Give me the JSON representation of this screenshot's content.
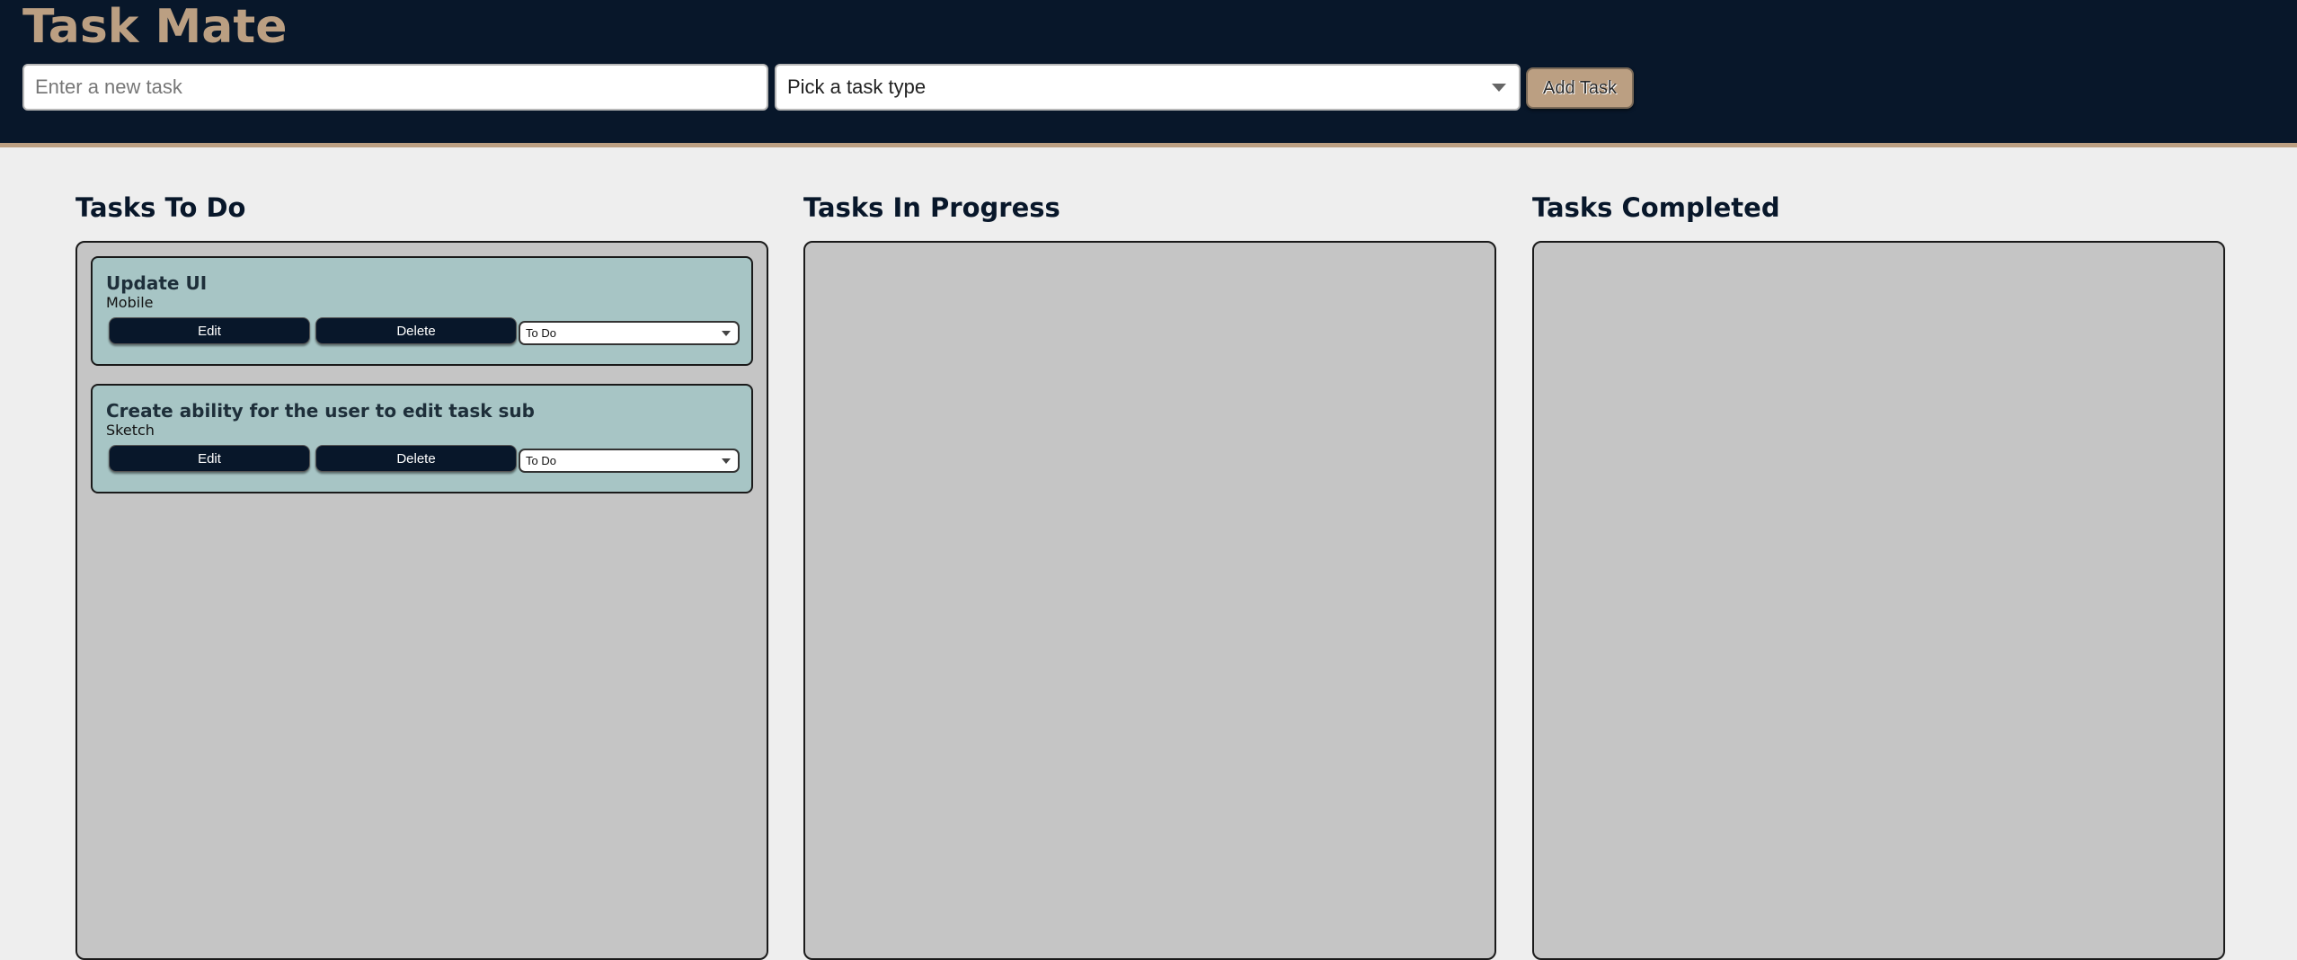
{
  "app": {
    "title": "Task Mate"
  },
  "form": {
    "task_placeholder": "Enter a new task",
    "task_value": "",
    "type_select_value": "Pick a task type",
    "add_button_label": "Add Task"
  },
  "columns": [
    {
      "title": "Tasks To Do",
      "tasks": [
        {
          "title": "Update UI",
          "type": "Mobile",
          "edit_label": "Edit",
          "delete_label": "Delete",
          "status": "To Do"
        },
        {
          "title": "Create ability for the user to edit task sub",
          "type": "Sketch",
          "edit_label": "Edit",
          "delete_label": "Delete",
          "status": "To Do"
        }
      ]
    },
    {
      "title": "Tasks In Progress",
      "tasks": []
    },
    {
      "title": "Tasks Completed",
      "tasks": []
    }
  ],
  "colors": {
    "header_bg": "#08172a",
    "accent": "#bb9f82",
    "panel_bg": "#c5c5c5",
    "card_bg": "#a7c5c5",
    "page_bg": "#eeeeee"
  },
  "icons": {
    "select_caret": "caret-down-icon"
  }
}
